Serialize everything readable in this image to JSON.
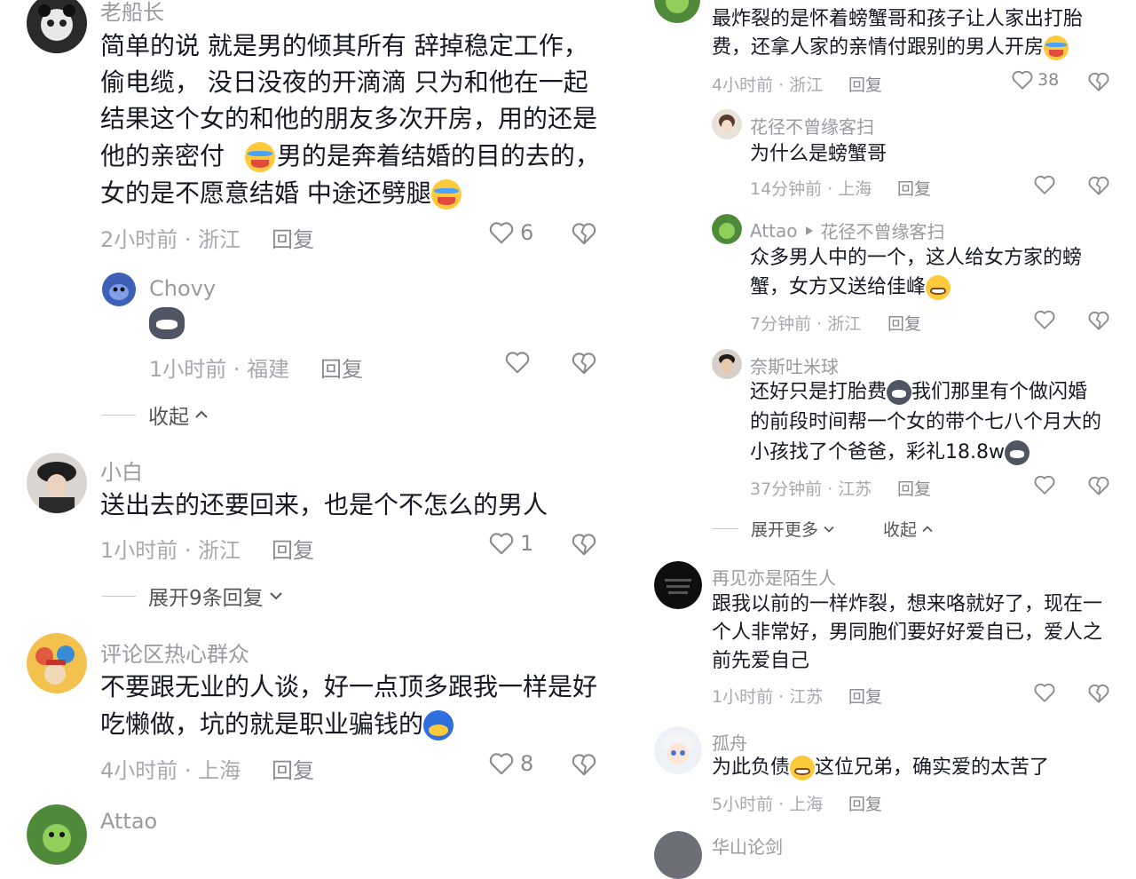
{
  "left": {
    "comments": [
      {
        "username": "老船长",
        "lines": [
          "简单的说  就是男的倾其所有  辞掉稳定工作，",
          "偷电缆，  没日没夜的开滴滴   只为和他在一起",
          "结果这个女的和他的朋友多次开房，用的还是",
          "他的亲密付",
          "男的是奔着结婚的目的去的，",
          "女的是不愿意结婚   中途还劈腿"
        ],
        "time_location": "2小时前 · 浙江",
        "reply": "回复",
        "likes": "6"
      },
      {
        "username": "Chovy",
        "time_location": "1小时前 · 福建",
        "reply": "回复",
        "likes": ""
      },
      {
        "username": "小白",
        "lines": [
          "送出去的还要回来，也是个不怎么的男人"
        ],
        "time_location": "1小时前 · 浙江",
        "reply": "回复",
        "likes": "1"
      },
      {
        "username": "评论区热心群众",
        "lines": [
          "不要跟无业的人谈，好一点顶多跟我一样是好",
          "吃懒做，坑的就是职业骗钱的"
        ],
        "time_location": "4小时前 · 上海",
        "reply": "回复",
        "likes": "8"
      },
      {
        "username": "Attao"
      }
    ],
    "collapse": "收起",
    "expand_more": "展开9条回复"
  },
  "right": {
    "comments": [
      {
        "lines": [
          "最炸裂的是怀着螃蟹哥和孩子让人家出打胎",
          "费，还拿人家的亲情付跟别的男人开房"
        ],
        "time_location": "4小时前 · 浙江",
        "reply": "回复",
        "likes": "38"
      },
      {
        "username": "花径不曾缘客扫",
        "lines": [
          "为什么是螃蟹哥"
        ],
        "time_location": "14分钟前 · 上海",
        "reply": "回复"
      },
      {
        "username": "Attao",
        "reply_to": "花径不曾缘客扫",
        "lines": [
          "众多男人中的一个，这人给女方家的螃",
          "蟹，女方又送给佳峰"
        ],
        "time_location": "7分钟前 · 浙江",
        "reply": "回复"
      },
      {
        "username": "奈斯吐米球",
        "lines": [
          "还好只是打胎费",
          "我们那里有个做闪婚",
          "的前段时间帮一个女的带个七八个月大的",
          "小孩找了个爸爸，彩礼18.8w"
        ],
        "time_location": "37分钟前 · 江苏",
        "reply": "回复"
      },
      {
        "username": "再见亦是陌生人",
        "lines": [
          "跟我以前的一样炸裂，想来咯就好了，现在一",
          "个人非常好，男同胞们要好好爱自已，爱人之",
          "前先爱自己"
        ],
        "time_location": "1小时前 · 江苏",
        "reply": "回复"
      },
      {
        "username": "孤舟",
        "lines": [
          "为此负债",
          "这位兄弟，确实爱的太苦了"
        ],
        "time_location": "5小时前 · 上海",
        "reply": "回复"
      },
      {
        "username": "华山论剑"
      }
    ],
    "expand_more": "展开更多",
    "collapse": "收起"
  },
  "icons": {
    "like": "heart-outline-icon",
    "dislike": "broken-heart-icon",
    "chevron_up": "chevron-up-icon",
    "chevron_down": "chevron-down-icon",
    "reply_arrow": "triangle-right-icon"
  },
  "colors": {
    "text": "#161823",
    "muted": "#a8a8ae",
    "username": "#9a9aa0",
    "background": "#ffffff"
  }
}
